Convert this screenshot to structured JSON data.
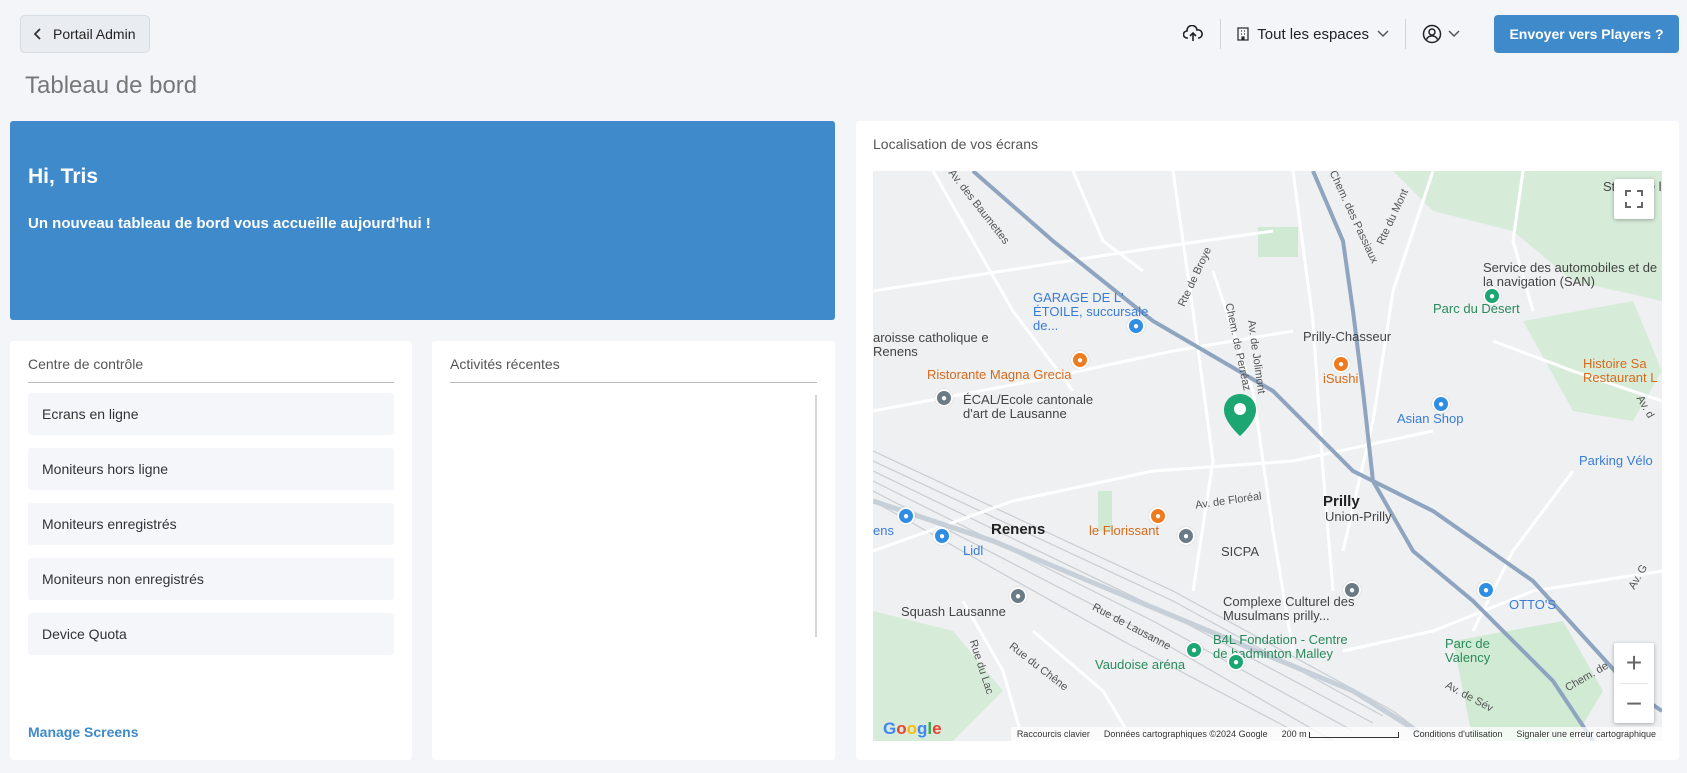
{
  "header": {
    "back_label": "Portail Admin",
    "page_title": "Tableau de bord",
    "space_select": "Tout les espaces",
    "send_button": "Envoyer vers Players ?"
  },
  "welcome": {
    "greeting": "Hi, Tris",
    "message": "Un nouveau tableau de bord vous accueille aujourd'hui !"
  },
  "control_center": {
    "title": "Centre de contrôle",
    "items": [
      "Ecrans en ligne",
      "Moniteurs hors ligne",
      "Moniteurs enregistrés",
      "Moniteurs non enregistrés",
      "Device Quota"
    ],
    "manage_link": "Manage Screens"
  },
  "activities": {
    "title": "Activités récentes"
  },
  "map": {
    "title": "Localisation de vos écrans",
    "labels": {
      "renens": "Renens",
      "prilly": "Prilly",
      "prilly_chasseur": "Prilly-Chasseur",
      "union_prilly": "Union-Prilly",
      "garage": "GARAGE DE L' ÉTOILE, succursale de...",
      "paroisse": "aroisse catholique e Renens",
      "magna_grecia": "Ristorante Magna Grecia",
      "ecal": "ÉCAL/Ecole cantonale d'art de Lausanne",
      "isushi": "iSushi",
      "asian_shop": "Asian Shop",
      "parking": "Parking Vélo",
      "service_auto": "Service des automobiles et de la navigation (SAN)",
      "parc_desert": "Parc du Désert",
      "histoire": "Histoire Sa Restaurant L",
      "stade": "Stade de l",
      "florissant": "le Florissant",
      "sicpa": "SICPA",
      "lidl": "Lidl",
      "ens": "ens",
      "squash": "Squash Lausanne",
      "complexe": "Complexe Culturel des Musulmans prilly...",
      "b4l": "B4L Fondation - Centre de badminton Malley",
      "vaudoise": "Vaudoise aréna",
      "ottos": "OTTO'S",
      "parc_valency": "Parc de Valency",
      "rue_lausanne": "Rue de Lausanne",
      "rue_lac": "Rue du Lac",
      "rue_chene": "Rue du Chêne",
      "av_floreal": "Av. de Floréal",
      "av_baumettes": "Av. des Baumettes",
      "rte_broye": "Rte de Broye",
      "chem_perreaz": "Chem. de Perréaz",
      "av_jolimont": "Av. de Jolimont",
      "chem_passiaux": "Chem. des Passiaux",
      "rte_mont": "Rte du Mont",
      "chem": "Chem. de",
      "av_sev": "Av. de Sév",
      "av_g": "Av. G",
      "av_right": "Av. d"
    },
    "attribution": {
      "shortcuts": "Raccourcis clavier",
      "data": "Données cartographiques ©2024 Google",
      "scale": "200 m",
      "terms": "Conditions d'utilisation",
      "report": "Signaler une erreur cartographique",
      "google": "Google"
    }
  },
  "icons": [
    "chevron-left-icon",
    "cloud-upload-icon",
    "building-icon",
    "chevron-down-icon",
    "user-circle-icon",
    "fullscreen-icon",
    "map-pin-icon"
  ],
  "colors": {
    "accent": "#3f8acb",
    "background": "#f3f5f9",
    "pin_green": "#1ba672"
  }
}
